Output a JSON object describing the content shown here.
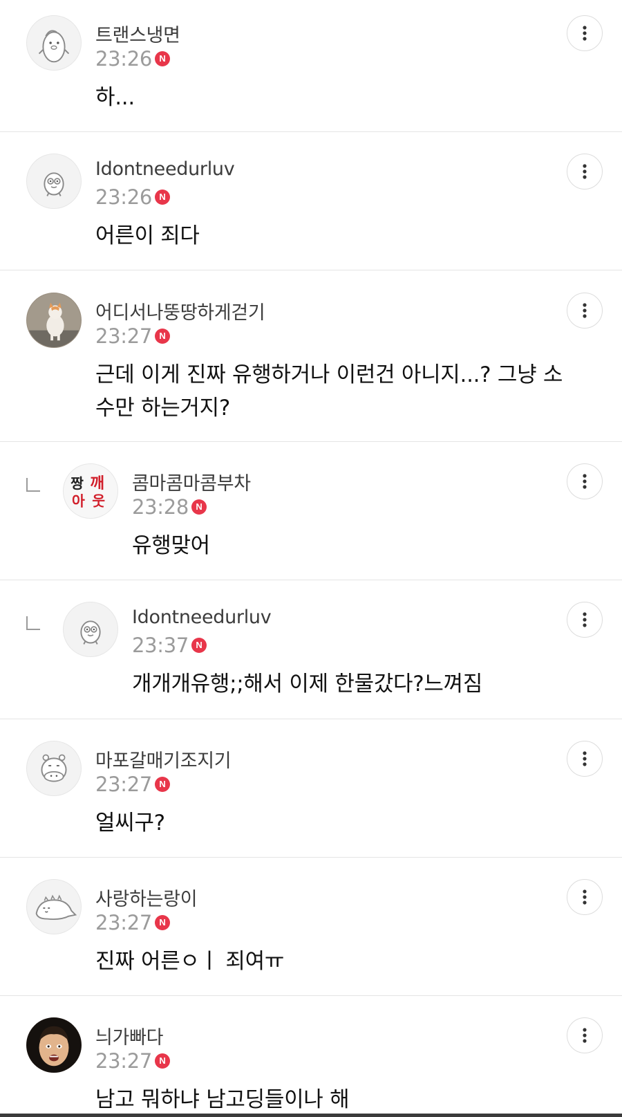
{
  "comments": [
    {
      "nickname": "트랜스냉면",
      "time": "23:26",
      "badge": "N",
      "text": "하...",
      "avatar_icon": "penguin-avatar-icon",
      "reply": false
    },
    {
      "nickname": "Idontneedurluv",
      "time": "23:26",
      "badge": "N",
      "text": "어른이 죄다",
      "avatar_icon": "duck-avatar-icon",
      "reply": false
    },
    {
      "nickname": "어디서나뚱땅하게걷기",
      "time": "23:27",
      "badge": "N",
      "text": "근데 이게 진짜 유행하거나 이런건 아니지...? 그냥 소수만 하는거지?",
      "avatar_icon": "cat-photo-avatar-icon",
      "reply": false
    },
    {
      "nickname": "콤마콤마콤부차",
      "time": "23:28",
      "badge": "N",
      "text": "유행맞어",
      "avatar_icon": "jjang-kkae-avatar-icon",
      "avatar_text": [
        "짱",
        "깨",
        "아",
        "웃"
      ],
      "reply": true
    },
    {
      "nickname": "Idontneedurluv",
      "time": "23:37",
      "badge": "N",
      "text": "개개개유행;;해서 이제 한물갔다?느껴짐",
      "avatar_icon": "duck-avatar-icon",
      "reply": true
    },
    {
      "nickname": "마포갈매기조지기",
      "time": "23:27",
      "badge": "N",
      "text": "얼씨구?",
      "avatar_icon": "hippo-avatar-icon",
      "reply": false
    },
    {
      "nickname": "사랑하는랑이",
      "time": "23:27",
      "badge": "N",
      "text": "진짜 어른ㅇㅣ 죄여ㅠ",
      "avatar_icon": "dinosaur-avatar-icon",
      "reply": false
    },
    {
      "nickname": "늬가빠다",
      "time": "23:27",
      "badge": "N",
      "text": "남고 뭐하냐 남고딩들이나 해",
      "avatar_icon": "face-photo-avatar-icon",
      "reply": false
    }
  ],
  "colors": {
    "new_badge": "#e8364a",
    "divider": "#e4e4e4",
    "timestamp": "#9b9b9b"
  },
  "more_button_icon": "more-vertical-icon"
}
